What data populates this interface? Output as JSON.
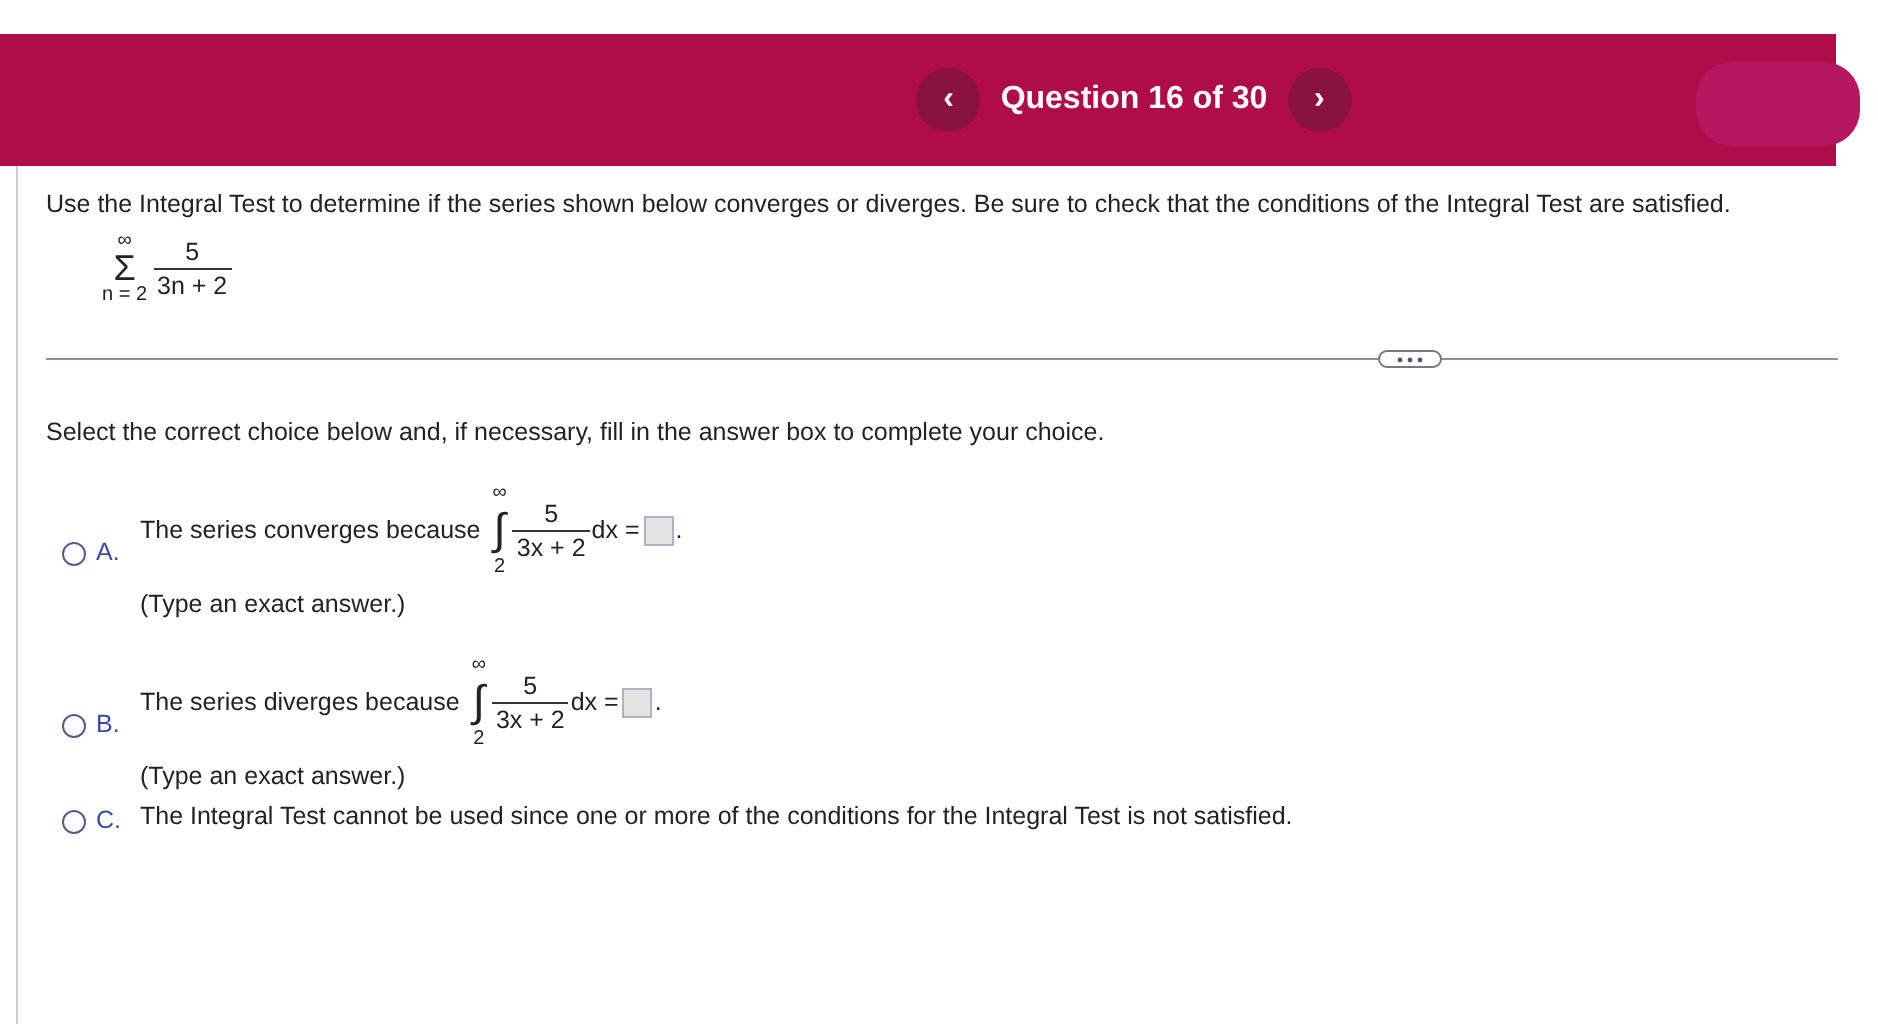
{
  "header": {
    "prev": "‹",
    "title": "Question 16 of 30",
    "next": "›"
  },
  "question": "Use the Integral Test to determine if the series shown below converges or diverges. Be sure to check that the conditions of the Integral Test are satisfied.",
  "series": {
    "upper": "∞",
    "sign": "Σ",
    "lower": "n = 2",
    "numerator": "5",
    "denominator": "3n + 2"
  },
  "instructions": "Select the correct choice below and, if necessary, fill in the answer box to complete your choice.",
  "choices": [
    {
      "kind": "integral",
      "letter": "A.",
      "selected": false,
      "text": "The series converges because",
      "integral": {
        "upper": "∞",
        "sign": "∫",
        "lower": "2",
        "numerator": "5",
        "denominator": "3x + 2",
        "tail": "dx =",
        "end": "."
      },
      "note": "(Type an exact answer.)"
    },
    {
      "kind": "integral",
      "letter": "B.",
      "selected": false,
      "text": "The series diverges because",
      "integral": {
        "upper": "∞",
        "sign": "∫",
        "lower": "2",
        "numerator": "5",
        "denominator": "3x + 2",
        "tail": "dx =",
        "end": "."
      },
      "note": "(Type an exact answer.)"
    },
    {
      "kind": "plain",
      "letter": "C.",
      "selected": false,
      "text": "The Integral Test cannot be used since one or more of the conditions for the Integral Test is not satisfied."
    }
  ]
}
